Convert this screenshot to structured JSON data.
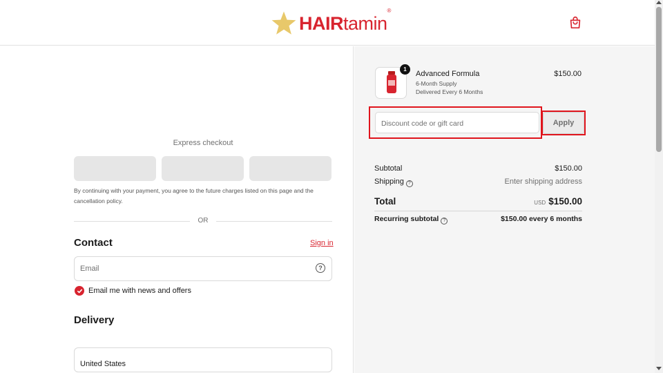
{
  "header": {
    "logo_bold": "HAIR",
    "logo_rest": "tamin",
    "logo_mark": "®",
    "brand_color": "#d8242f",
    "star_color": "#e8c86a",
    "cart_icon": "shopping-bag-icon"
  },
  "express": {
    "label": "Express checkout",
    "terms": "By continuing with your payment, you agree to the future charges listed on this page and the cancellation policy.",
    "or": "OR"
  },
  "contact": {
    "title": "Contact",
    "signin": "Sign in",
    "email_placeholder": "Email",
    "newsletter_label": "Email me with news and offers",
    "newsletter_checked": true
  },
  "delivery": {
    "title": "Delivery",
    "country": "United States"
  },
  "order": {
    "product_name": "Advanced Formula",
    "supply": "6-Month Supply",
    "delivery_frequency": "Delivered Every 6 Months",
    "quantity": "1",
    "price": "$150.00"
  },
  "discount": {
    "placeholder": "Discount code or gift card",
    "apply_label": "Apply"
  },
  "summary": {
    "subtotal_label": "Subtotal",
    "subtotal_value": "$150.00",
    "shipping_label": "Shipping",
    "shipping_value": "Enter shipping address",
    "total_label": "Total",
    "currency": "USD",
    "total_value": "$150.00",
    "recurring_label": "Recurring subtotal",
    "recurring_value": "$150.00 every 6 months"
  }
}
